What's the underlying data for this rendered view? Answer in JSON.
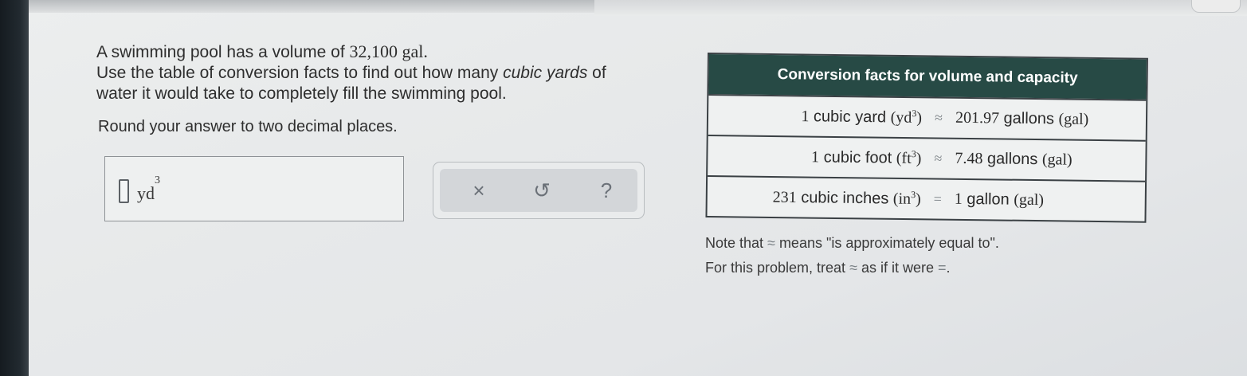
{
  "question": {
    "line1_pre": "A swimming pool has a volume of ",
    "volume": "32,100",
    "volume_unit": " gal.",
    "line2_pre": "Use the table of conversion facts to find out how many ",
    "line2_em": "cubic yards",
    "line2_post": " of",
    "line3": "water it would take to completely fill the swimming pool.",
    "round": "Round your answer to two decimal places."
  },
  "answer": {
    "value": "",
    "unit": "yd",
    "unit_exp": "3"
  },
  "tools": {
    "clear": "×",
    "undo": "↺",
    "help": "?"
  },
  "table": {
    "title": "Conversion facts for volume and capacity",
    "rows": [
      {
        "lhs_num": "1",
        "lhs_text": " cubic yard ",
        "lhs_unit": "yd",
        "lhs_exp": "3",
        "rel": "≈",
        "rhs_num": "201.97",
        "rhs_text": " gallons ",
        "rhs_unit": "gal"
      },
      {
        "lhs_num": "1",
        "lhs_text": " cubic foot ",
        "lhs_unit": "ft",
        "lhs_exp": "3",
        "rel": "≈",
        "rhs_num": "7.48",
        "rhs_text": " gallons ",
        "rhs_unit": "gal"
      },
      {
        "lhs_num": "231",
        "lhs_text": " cubic inches ",
        "lhs_unit": "in",
        "lhs_exp": "3",
        "rel": "=",
        "rhs_num": "1",
        "rhs_text": " gallon ",
        "rhs_unit": "gal"
      }
    ]
  },
  "note": {
    "line1_pre": "Note that ",
    "line1_sym": "≈",
    "line1_post": " means \"is approximately equal to\".",
    "line2_pre": "For this problem, treat ",
    "line2_sym": "≈",
    "line2_mid": " as if it were ",
    "line2_sym2": "=",
    "line2_post": "."
  }
}
